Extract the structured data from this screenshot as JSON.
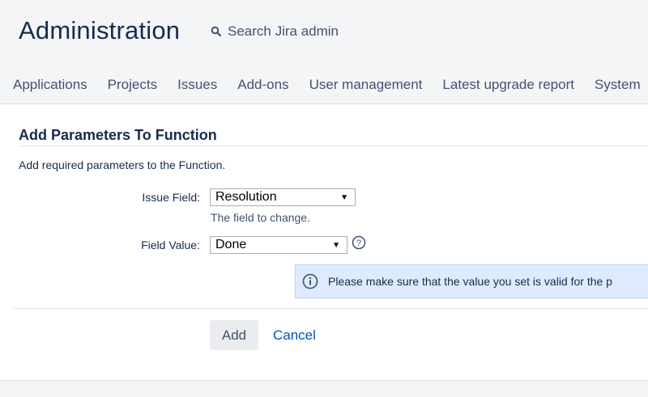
{
  "header": {
    "title": "Administration",
    "search_placeholder": "Search Jira admin"
  },
  "nav": {
    "items": [
      "Applications",
      "Projects",
      "Issues",
      "Add-ons",
      "User management",
      "Latest upgrade report",
      "System"
    ]
  },
  "panel": {
    "title": "Add Parameters To Function",
    "description": "Add required parameters to the Function.",
    "issue_field": {
      "label": "Issue Field:",
      "value": "Resolution",
      "help": "The field to change."
    },
    "field_value": {
      "label": "Field Value:",
      "value": "Done"
    },
    "info_message": "Please make sure that the value you set is valid for the p",
    "add_label": "Add",
    "cancel_label": "Cancel"
  },
  "colors": {
    "link": "#0052cc",
    "info_background": "#deebff",
    "text": "#172b4d"
  },
  "icons": [
    "search-icon",
    "help-icon",
    "info-icon",
    "dropdown-arrow-icon"
  ]
}
